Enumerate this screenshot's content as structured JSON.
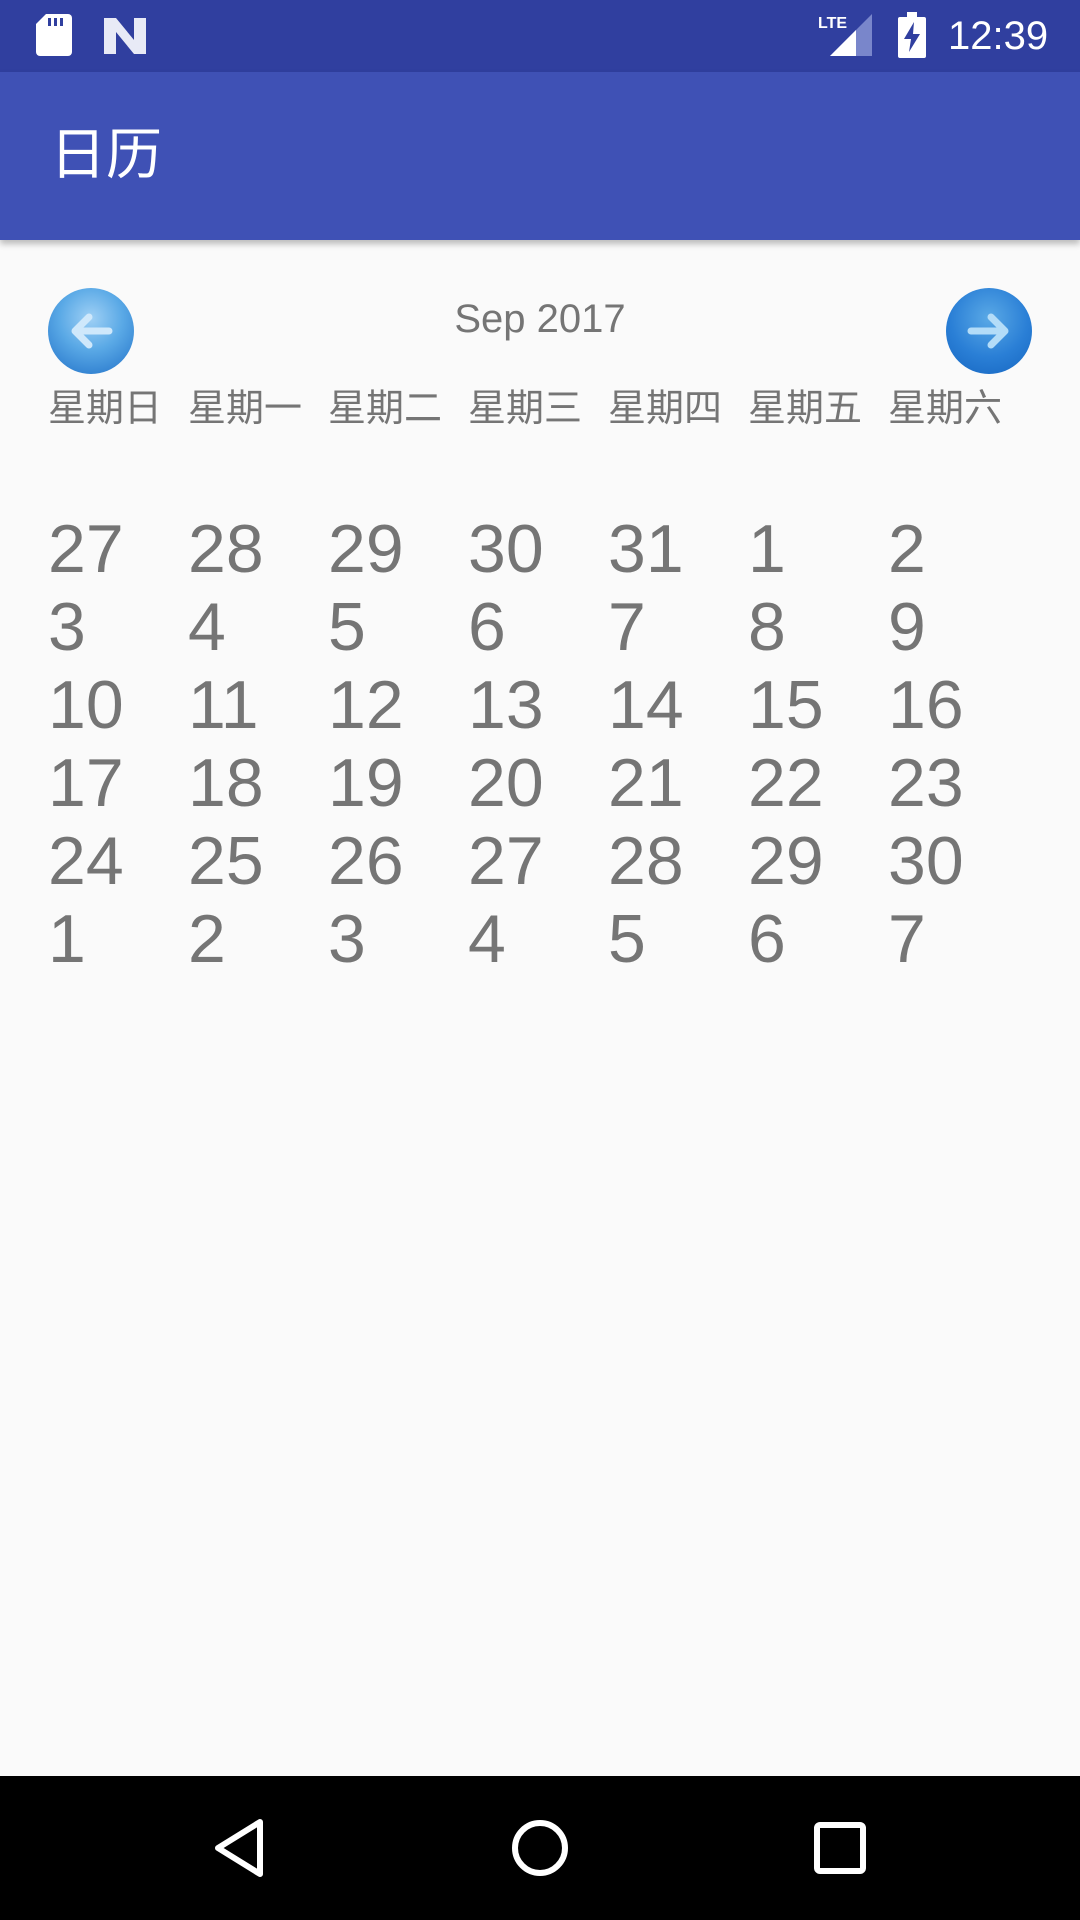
{
  "status_bar": {
    "time": "12:39",
    "network_label": "LTE",
    "icons": [
      "sd-card-icon",
      "n-notification-icon",
      "lte-signal-icon",
      "battery-charging-icon"
    ]
  },
  "app_bar": {
    "title": "日历",
    "background_color": "#3f51b5",
    "status_color": "#303f9f"
  },
  "calendar": {
    "month_label": "Sep 2017",
    "prev_icon": "arrow-left-icon",
    "next_icon": "arrow-right-icon",
    "weekdays": [
      "星期日",
      "星期一",
      "星期二",
      "星期三",
      "星期四",
      "星期五",
      "星期六"
    ],
    "weeks": [
      [
        "27",
        "28",
        "29",
        "30",
        "31",
        "1",
        "2"
      ],
      [
        "3",
        "4",
        "5",
        "6",
        "7",
        "8",
        "9"
      ],
      [
        "10",
        "11",
        "12",
        "13",
        "14",
        "15",
        "16"
      ],
      [
        "17",
        "18",
        "19",
        "20",
        "21",
        "22",
        "23"
      ],
      [
        "24",
        "25",
        "26",
        "27",
        "28",
        "29",
        "30"
      ],
      [
        "1",
        "2",
        "3",
        "4",
        "5",
        "6",
        "7"
      ]
    ]
  },
  "navigation_bar": {
    "buttons": [
      "back-icon",
      "home-icon",
      "recents-icon"
    ]
  }
}
